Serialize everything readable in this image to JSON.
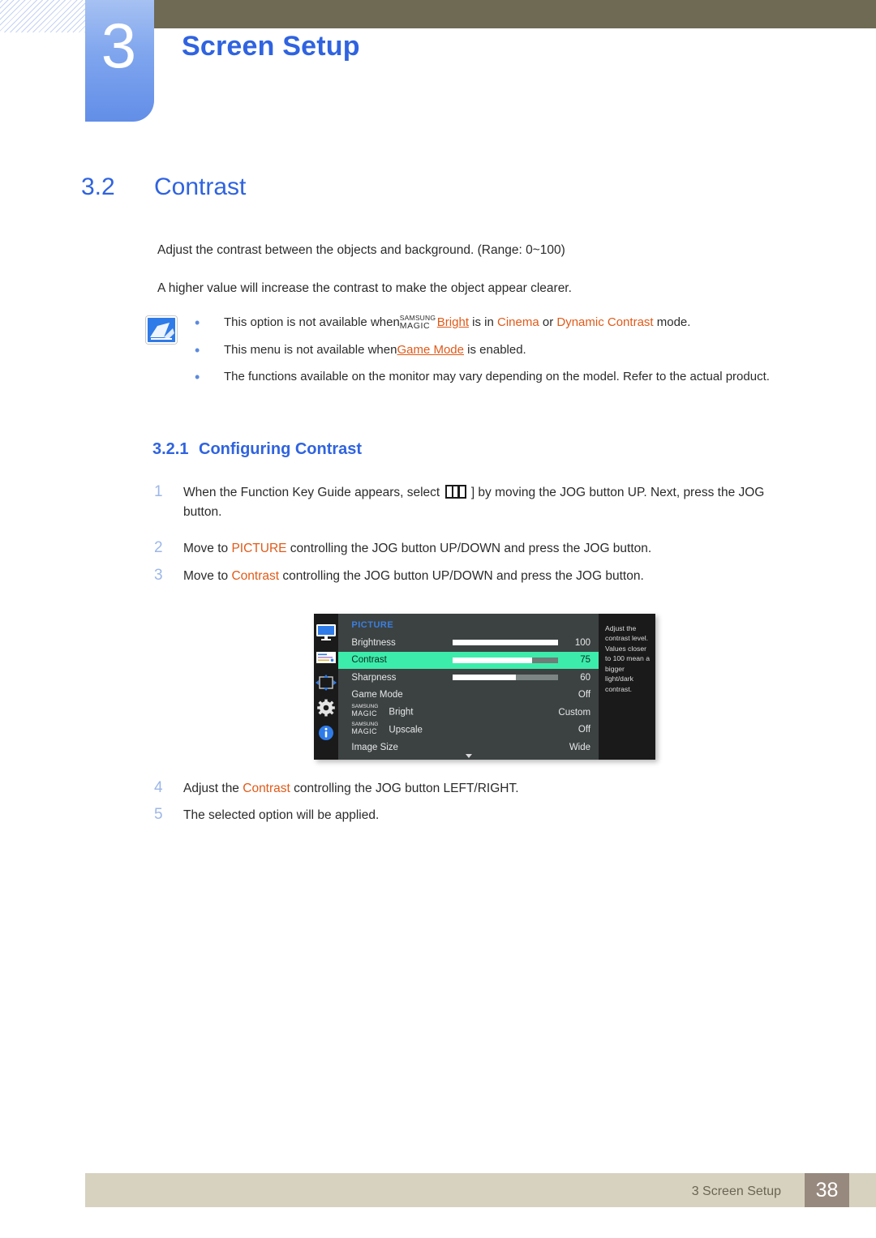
{
  "chapter": {
    "number": "3",
    "title": "Screen Setup"
  },
  "section": {
    "number": "3.2",
    "title": "Contrast"
  },
  "paragraphs": {
    "p1": "Adjust the contrast between the objects and background. (Range: 0~100)",
    "p2": "A higher value will increase the contrast to make the object appear clearer."
  },
  "note": {
    "icon": "note-pencil-icon",
    "bullet_glyph": "•",
    "items": [
      {
        "pre": "This option is not available when",
        "magic_line1": "SAMSUNG",
        "magic_line2": "MAGIC",
        "link": "Bright",
        "mid": " is in ",
        "term1": "Cinema",
        "conj": " or ",
        "term2": "Dynamic Contrast",
        "post": " mode."
      },
      {
        "pre": "This menu is not available when",
        "link": "Game Mode",
        "post": " is enabled."
      },
      {
        "text": "The functions available on the monitor may vary depending on the model. Refer to the actual product."
      }
    ]
  },
  "subsection": {
    "number": "3.2.1",
    "title": "Configuring Contrast"
  },
  "steps": [
    {
      "n": "1",
      "pre": "When the Function Key Guide appears, select ",
      "icon": "function-key-guide-icon",
      "post": " ] by moving the JOG button UP. Next, press the JOG button."
    },
    {
      "n": "2",
      "pre": "Move to ",
      "highlight": "PICTURE",
      "post": " controlling the JOG button UP/DOWN and press the JOG button."
    },
    {
      "n": "3",
      "pre": "Move to ",
      "highlight": "Contrast",
      "post": " controlling the JOG button UP/DOWN and press the JOG button."
    },
    {
      "n": "4",
      "pre": "Adjust the ",
      "highlight": "Contrast",
      "post": " controlling the JOG button LEFT/RIGHT."
    },
    {
      "n": "5",
      "pre": "The selected option will be applied.",
      "highlight": "",
      "post": ""
    }
  ],
  "osd": {
    "title": "PICTURE",
    "rail_icons": [
      "monitor-icon",
      "onscreen-display-icon",
      "position-arrows-icon",
      "gear-icon",
      "info-icon"
    ],
    "rows": [
      {
        "label": "Brightness",
        "value": "100",
        "slider": 100,
        "selected": false
      },
      {
        "label": "Contrast",
        "value": "75",
        "slider": 75,
        "selected": true
      },
      {
        "label": "Sharpness",
        "value": "60",
        "slider": 60,
        "selected": false
      },
      {
        "label": "Game Mode",
        "value": "Off",
        "slider": null,
        "selected": false
      },
      {
        "label": "Bright",
        "value": "Custom",
        "slider": null,
        "selected": false,
        "magic_line1": "SAMSUNG",
        "magic_line2": "MAGIC"
      },
      {
        "label": "Upscale",
        "value": "Off",
        "slider": null,
        "selected": false,
        "magic_line1": "SAMSUNG",
        "magic_line2": "MAGIC"
      },
      {
        "label": "Image Size",
        "value": "Wide",
        "slider": null,
        "selected": false
      }
    ],
    "help_text": "Adjust the contrast level. Values closer to 100 mean a bigger light/dark contrast.",
    "scroll_caret": "▼",
    "colors": {
      "selected_row": "#3cecab",
      "title": "#3b7fe0",
      "panel": "#3c4242",
      "rail": "#1a1a1a"
    }
  },
  "footer": {
    "label": "3 Screen Setup",
    "page": "38"
  },
  "colors": {
    "heading_blue": "#2f63e0",
    "accent_orange": "#e05a19",
    "olive": "#6e6a54",
    "footer_bar": "#d7d2c0",
    "footer_page_bg": "#98897e",
    "badge_blue": "#7fa5ee"
  }
}
